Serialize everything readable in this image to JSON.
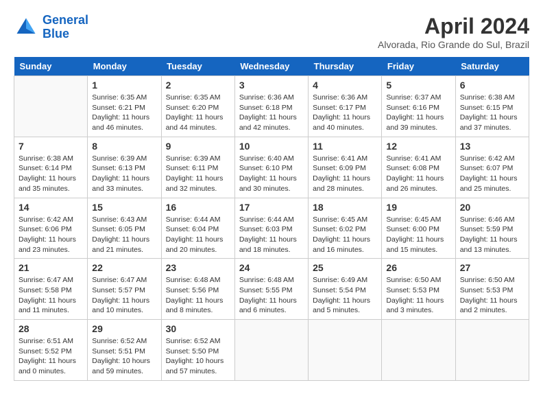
{
  "header": {
    "logo_line1": "General",
    "logo_line2": "Blue",
    "month": "April 2024",
    "location": "Alvorada, Rio Grande do Sul, Brazil"
  },
  "columns": [
    "Sunday",
    "Monday",
    "Tuesday",
    "Wednesday",
    "Thursday",
    "Friday",
    "Saturday"
  ],
  "weeks": [
    [
      {
        "day": "",
        "sunrise": "",
        "sunset": "",
        "daylight": ""
      },
      {
        "day": "1",
        "sunrise": "Sunrise: 6:35 AM",
        "sunset": "Sunset: 6:21 PM",
        "daylight": "Daylight: 11 hours and 46 minutes."
      },
      {
        "day": "2",
        "sunrise": "Sunrise: 6:35 AM",
        "sunset": "Sunset: 6:20 PM",
        "daylight": "Daylight: 11 hours and 44 minutes."
      },
      {
        "day": "3",
        "sunrise": "Sunrise: 6:36 AM",
        "sunset": "Sunset: 6:18 PM",
        "daylight": "Daylight: 11 hours and 42 minutes."
      },
      {
        "day": "4",
        "sunrise": "Sunrise: 6:36 AM",
        "sunset": "Sunset: 6:17 PM",
        "daylight": "Daylight: 11 hours and 40 minutes."
      },
      {
        "day": "5",
        "sunrise": "Sunrise: 6:37 AM",
        "sunset": "Sunset: 6:16 PM",
        "daylight": "Daylight: 11 hours and 39 minutes."
      },
      {
        "day": "6",
        "sunrise": "Sunrise: 6:38 AM",
        "sunset": "Sunset: 6:15 PM",
        "daylight": "Daylight: 11 hours and 37 minutes."
      }
    ],
    [
      {
        "day": "7",
        "sunrise": "Sunrise: 6:38 AM",
        "sunset": "Sunset: 6:14 PM",
        "daylight": "Daylight: 11 hours and 35 minutes."
      },
      {
        "day": "8",
        "sunrise": "Sunrise: 6:39 AM",
        "sunset": "Sunset: 6:13 PM",
        "daylight": "Daylight: 11 hours and 33 minutes."
      },
      {
        "day": "9",
        "sunrise": "Sunrise: 6:39 AM",
        "sunset": "Sunset: 6:11 PM",
        "daylight": "Daylight: 11 hours and 32 minutes."
      },
      {
        "day": "10",
        "sunrise": "Sunrise: 6:40 AM",
        "sunset": "Sunset: 6:10 PM",
        "daylight": "Daylight: 11 hours and 30 minutes."
      },
      {
        "day": "11",
        "sunrise": "Sunrise: 6:41 AM",
        "sunset": "Sunset: 6:09 PM",
        "daylight": "Daylight: 11 hours and 28 minutes."
      },
      {
        "day": "12",
        "sunrise": "Sunrise: 6:41 AM",
        "sunset": "Sunset: 6:08 PM",
        "daylight": "Daylight: 11 hours and 26 minutes."
      },
      {
        "day": "13",
        "sunrise": "Sunrise: 6:42 AM",
        "sunset": "Sunset: 6:07 PM",
        "daylight": "Daylight: 11 hours and 25 minutes."
      }
    ],
    [
      {
        "day": "14",
        "sunrise": "Sunrise: 6:42 AM",
        "sunset": "Sunset: 6:06 PM",
        "daylight": "Daylight: 11 hours and 23 minutes."
      },
      {
        "day": "15",
        "sunrise": "Sunrise: 6:43 AM",
        "sunset": "Sunset: 6:05 PM",
        "daylight": "Daylight: 11 hours and 21 minutes."
      },
      {
        "day": "16",
        "sunrise": "Sunrise: 6:44 AM",
        "sunset": "Sunset: 6:04 PM",
        "daylight": "Daylight: 11 hours and 20 minutes."
      },
      {
        "day": "17",
        "sunrise": "Sunrise: 6:44 AM",
        "sunset": "Sunset: 6:03 PM",
        "daylight": "Daylight: 11 hours and 18 minutes."
      },
      {
        "day": "18",
        "sunrise": "Sunrise: 6:45 AM",
        "sunset": "Sunset: 6:02 PM",
        "daylight": "Daylight: 11 hours and 16 minutes."
      },
      {
        "day": "19",
        "sunrise": "Sunrise: 6:45 AM",
        "sunset": "Sunset: 6:00 PM",
        "daylight": "Daylight: 11 hours and 15 minutes."
      },
      {
        "day": "20",
        "sunrise": "Sunrise: 6:46 AM",
        "sunset": "Sunset: 5:59 PM",
        "daylight": "Daylight: 11 hours and 13 minutes."
      }
    ],
    [
      {
        "day": "21",
        "sunrise": "Sunrise: 6:47 AM",
        "sunset": "Sunset: 5:58 PM",
        "daylight": "Daylight: 11 hours and 11 minutes."
      },
      {
        "day": "22",
        "sunrise": "Sunrise: 6:47 AM",
        "sunset": "Sunset: 5:57 PM",
        "daylight": "Daylight: 11 hours and 10 minutes."
      },
      {
        "day": "23",
        "sunrise": "Sunrise: 6:48 AM",
        "sunset": "Sunset: 5:56 PM",
        "daylight": "Daylight: 11 hours and 8 minutes."
      },
      {
        "day": "24",
        "sunrise": "Sunrise: 6:48 AM",
        "sunset": "Sunset: 5:55 PM",
        "daylight": "Daylight: 11 hours and 6 minutes."
      },
      {
        "day": "25",
        "sunrise": "Sunrise: 6:49 AM",
        "sunset": "Sunset: 5:54 PM",
        "daylight": "Daylight: 11 hours and 5 minutes."
      },
      {
        "day": "26",
        "sunrise": "Sunrise: 6:50 AM",
        "sunset": "Sunset: 5:53 PM",
        "daylight": "Daylight: 11 hours and 3 minutes."
      },
      {
        "day": "27",
        "sunrise": "Sunrise: 6:50 AM",
        "sunset": "Sunset: 5:53 PM",
        "daylight": "Daylight: 11 hours and 2 minutes."
      }
    ],
    [
      {
        "day": "28",
        "sunrise": "Sunrise: 6:51 AM",
        "sunset": "Sunset: 5:52 PM",
        "daylight": "Daylight: 11 hours and 0 minutes."
      },
      {
        "day": "29",
        "sunrise": "Sunrise: 6:52 AM",
        "sunset": "Sunset: 5:51 PM",
        "daylight": "Daylight: 10 hours and 59 minutes."
      },
      {
        "day": "30",
        "sunrise": "Sunrise: 6:52 AM",
        "sunset": "Sunset: 5:50 PM",
        "daylight": "Daylight: 10 hours and 57 minutes."
      },
      {
        "day": "",
        "sunrise": "",
        "sunset": "",
        "daylight": ""
      },
      {
        "day": "",
        "sunrise": "",
        "sunset": "",
        "daylight": ""
      },
      {
        "day": "",
        "sunrise": "",
        "sunset": "",
        "daylight": ""
      },
      {
        "day": "",
        "sunrise": "",
        "sunset": "",
        "daylight": ""
      }
    ]
  ]
}
